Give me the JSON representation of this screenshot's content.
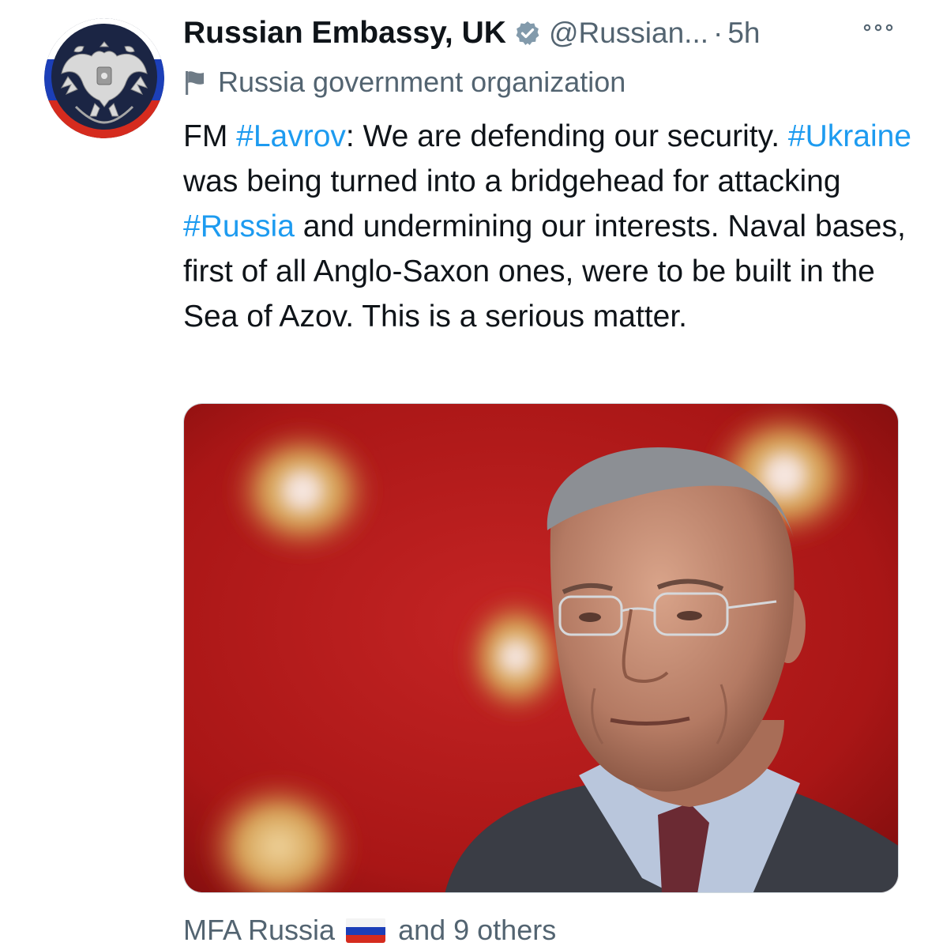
{
  "tweet": {
    "author_name": "Russian Embassy, UK",
    "author_handle": "@Russian...",
    "separator": "·",
    "time": "5h",
    "account_label": "Russia government organization",
    "text_segments": [
      {
        "text": "FM ",
        "type": "text"
      },
      {
        "text": "#Lavrov",
        "type": "hashtag"
      },
      {
        "text": ": We are defending our security. ",
        "type": "text"
      },
      {
        "text": "#Ukraine",
        "type": "hashtag"
      },
      {
        "text": " was being turned into a bridgehead for attacking ",
        "type": "text"
      },
      {
        "text": "#Russia",
        "type": "hashtag"
      },
      {
        "text": " and undermining our interests. Naval bases, first of all Anglo-Saxon ones, were to be built in the Sea of Azov. This is a serious matter.",
        "type": "text"
      }
    ],
    "tagged_first": "MFA Russia",
    "tagged_rest": "and 9 others"
  },
  "icons": {
    "verified": "verified-badge-icon",
    "more": "more-options-icon",
    "label": "flag-icon",
    "tagged_flag": "russia-flag-emoji"
  },
  "colors": {
    "hashtag": "#1d9bf0",
    "secondary_text": "#536471",
    "primary_text": "#0f1419",
    "photo_background": "#b01a1a"
  }
}
